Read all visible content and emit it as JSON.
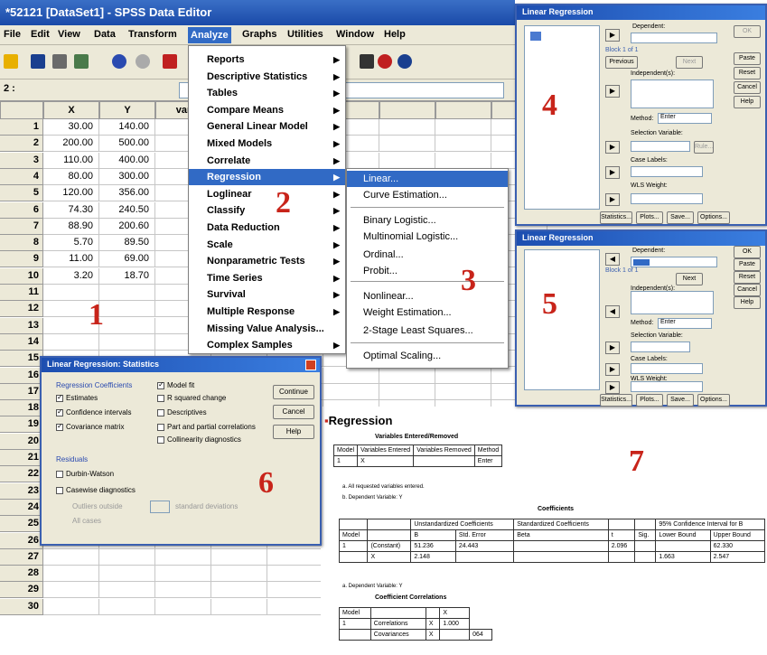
{
  "window": {
    "title": "*52121 [DataSet1] - SPSS Data Editor"
  },
  "menubar": [
    "File",
    "Edit",
    "View",
    "Data",
    "Transform",
    "Analyze",
    "Graphs",
    "Utilities",
    "Window",
    "Help"
  ],
  "cellref": "2 :",
  "grid": {
    "columns": [
      "X",
      "Y",
      "var"
    ],
    "rows": [
      {
        "n": "1",
        "x": "30.00",
        "y": "140.00"
      },
      {
        "n": "2",
        "x": "200.00",
        "y": "500.00"
      },
      {
        "n": "3",
        "x": "110.00",
        "y": "400.00"
      },
      {
        "n": "4",
        "x": "80.00",
        "y": "300.00"
      },
      {
        "n": "5",
        "x": "120.00",
        "y": "356.00"
      },
      {
        "n": "6",
        "x": "74.30",
        "y": "240.50"
      },
      {
        "n": "7",
        "x": "88.90",
        "y": "200.60"
      },
      {
        "n": "8",
        "x": "5.70",
        "y": "89.50"
      },
      {
        "n": "9",
        "x": "11.00",
        "y": "69.00"
      },
      {
        "n": "10",
        "x": "3.20",
        "y": "18.70"
      }
    ],
    "empty_rows": [
      "11",
      "12",
      "13",
      "14",
      "15",
      "16",
      "17",
      "18",
      "19",
      "20",
      "21",
      "22",
      "23",
      "24",
      "25",
      "26",
      "27",
      "28",
      "29",
      "30"
    ]
  },
  "analyze_menu": [
    "Reports",
    "Descriptive Statistics",
    "Tables",
    "Compare Means",
    "General Linear Model",
    "Mixed Models",
    "Correlate",
    "Regression",
    "Loglinear",
    "Classify",
    "Data Reduction",
    "Scale",
    "Nonparametric Tests",
    "Time Series",
    "Survival",
    "Multiple Response",
    "Missing Value Analysis...",
    "Complex Samples"
  ],
  "regression_submenu": [
    "Linear...",
    "Curve Estimation...",
    "Binary Logistic...",
    "Multinomial Logistic...",
    "Ordinal...",
    "Probit...",
    "Nonlinear...",
    "Weight Estimation...",
    "2-Stage Least Squares...",
    "Optimal Scaling..."
  ],
  "callouts": [
    "1",
    "2",
    "3",
    "4",
    "5",
    "6",
    "7"
  ],
  "dialog_lr": {
    "title": "Linear Regression",
    "dependent": "Dependent:",
    "block": "Block 1 of 1",
    "independents": "Independent(s):",
    "method_label": "Method:",
    "method": "Enter",
    "selection": "Selection Variable:",
    "case_labels": "Case Labels:",
    "wls": "WLS Weight:",
    "side_buttons": [
      "OK",
      "Paste",
      "Reset",
      "Cancel",
      "Help"
    ],
    "bottom_buttons": [
      "Statistics...",
      "Plots...",
      "Save...",
      "Options..."
    ],
    "prev": "Previous",
    "next": "Next",
    "rule": "Rule..."
  },
  "dialog_stats": {
    "title": "Linear Regression: Statistics",
    "group_coef": "Regression Coefficients",
    "estimates": "Estimates",
    "conf": "Confidence intervals",
    "cov": "Covariance matrix",
    "model_fit": "Model fit",
    "r_sq": "R squared change",
    "descriptives": "Descriptives",
    "part": "Part and partial correlations",
    "collin": "Collinearity diagnostics",
    "residuals": "Residuals",
    "dw": "Durbin-Watson",
    "casewise": "Casewise diagnostics",
    "outliers": "Outliers outside",
    "std": "standard deviations",
    "all": "All cases",
    "buttons": [
      "Continue",
      "Cancel",
      "Help"
    ]
  },
  "output": {
    "heading": "Regression",
    "t1_title": "Variables Entered/Removed",
    "t1_headers": [
      "Model",
      "Variables Entered",
      "Variables Removed",
      "Method"
    ],
    "t1_row": [
      "1",
      "X",
      "",
      "Enter"
    ],
    "t1_notes": [
      "a. All requested variables entered.",
      "b. Dependent Variable: Y"
    ],
    "t2_title": "Coefficients",
    "t2_headers": [
      "",
      "",
      "Unstandardized Coefficients",
      "Standardized Coefficients",
      "",
      "",
      "95% Confidence Interval for B"
    ],
    "t2_sub": [
      "Model",
      "",
      "B",
      "Std. Error",
      "Beta",
      "t",
      "Sig.",
      "Lower Bound",
      "Upper Bound"
    ],
    "t2_rows": [
      [
        "1",
        "(Constant)",
        "51.236",
        "24.443",
        "",
        "2.096",
        "",
        "",
        "62.330"
      ],
      [
        "",
        "X",
        "2.148",
        "",
        "",
        "",
        "",
        "1.663",
        "2.547"
      ]
    ],
    "t2_note": "a. Dependent Variable: Y",
    "t3_title": "Coefficient Correlations",
    "t3_rows": [
      [
        "Model",
        "",
        "",
        "X"
      ],
      [
        "1",
        "Correlations",
        "X",
        "1.000"
      ],
      [
        "",
        "Covariances",
        "X",
        "",
        "064"
      ]
    ]
  }
}
